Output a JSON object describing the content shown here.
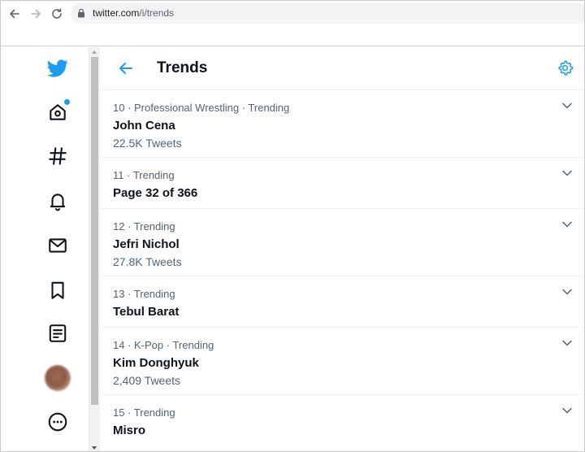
{
  "browser": {
    "url_host": "twitter.com",
    "url_path": "/i/trends"
  },
  "sidebar": {
    "items": [
      {
        "icon": "twitter-bird-icon"
      },
      {
        "icon": "home-icon",
        "has_notification_dot": true
      },
      {
        "icon": "hashtag-icon"
      },
      {
        "icon": "bell-icon"
      },
      {
        "icon": "mail-icon"
      },
      {
        "icon": "bookmark-icon"
      },
      {
        "icon": "lists-icon"
      },
      {
        "icon": "avatar"
      },
      {
        "icon": "more-icon"
      }
    ]
  },
  "header": {
    "title": "Trends",
    "back_icon": "arrow-left-icon",
    "settings_icon": "gear-icon"
  },
  "trends": [
    {
      "meta": "10 · Professional Wrestling · Trending",
      "name": "John Cena",
      "count": "22.5K Tweets"
    },
    {
      "meta": "11 · Trending",
      "name": "Page 32 of 366",
      "count": ""
    },
    {
      "meta": "12 · Trending",
      "name": "Jefri Nichol",
      "count": "27.8K Tweets"
    },
    {
      "meta": "13 · Trending",
      "name": "Tebul Barat",
      "count": ""
    },
    {
      "meta": "14 · K-Pop · Trending",
      "name": "Kim Donghyuk",
      "count": "2,409 Tweets"
    },
    {
      "meta": "15 · Trending",
      "name": "Misro",
      "count": ""
    }
  ],
  "colors": {
    "accent": "#1d9bf0",
    "text_primary": "#0f1419",
    "text_secondary": "#536471",
    "divider": "#eff3f4"
  }
}
